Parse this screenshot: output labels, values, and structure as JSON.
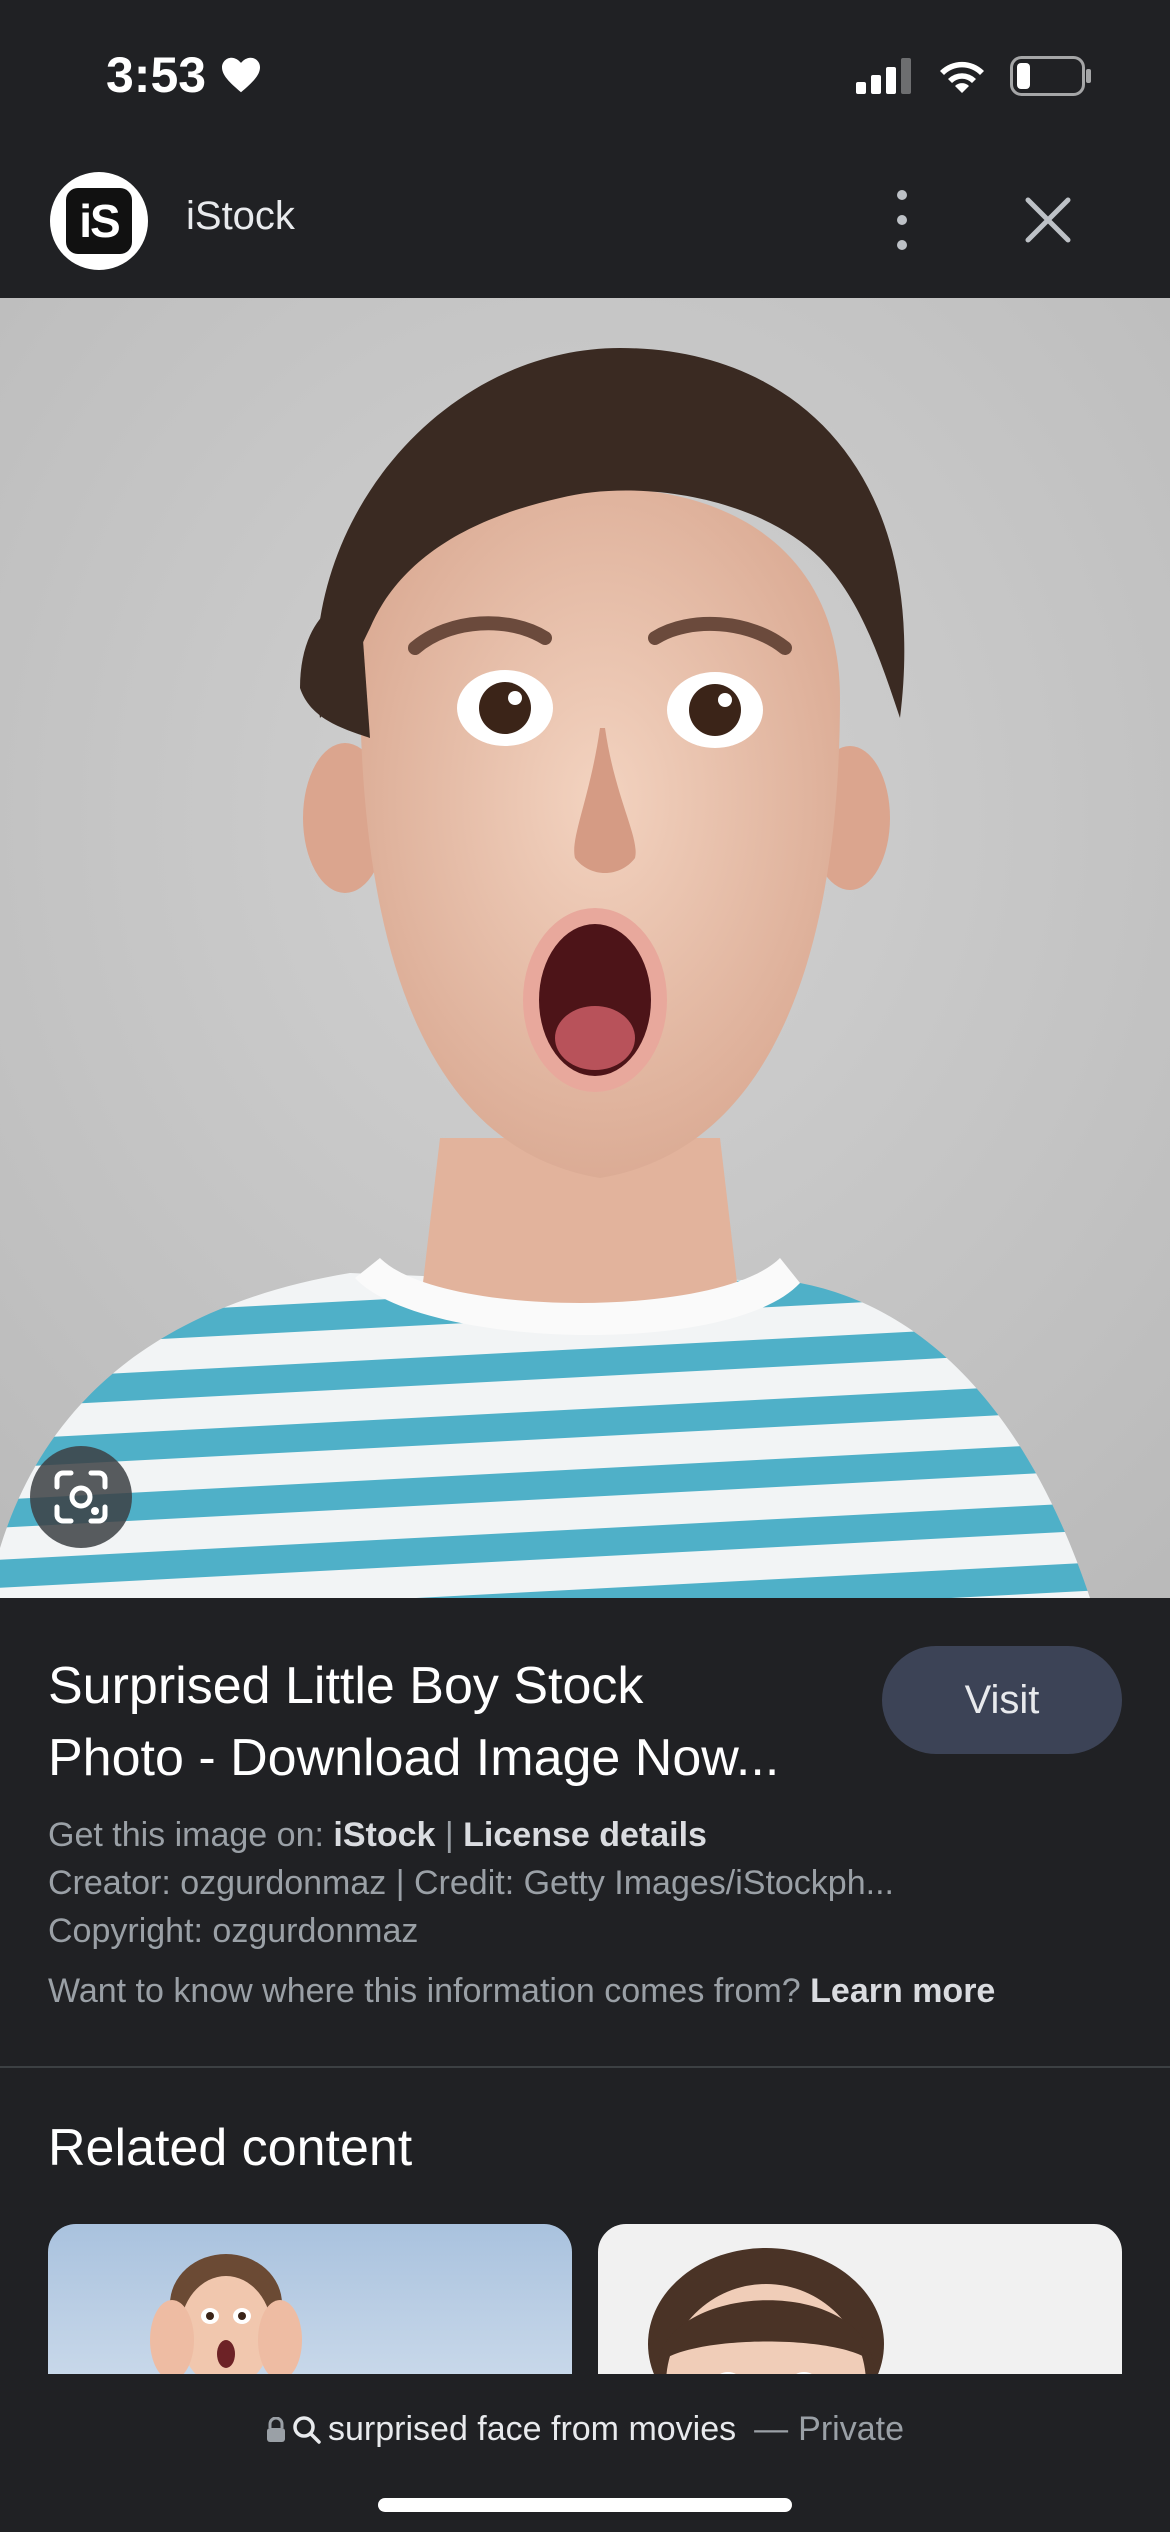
{
  "status_bar": {
    "time": "3:53",
    "icons": [
      "heart-icon",
      "signal-icon",
      "wifi-icon",
      "battery-icon"
    ]
  },
  "header": {
    "logo_text": "iS",
    "title": "iStock",
    "icons": [
      "more-vert-icon",
      "close-icon"
    ]
  },
  "image": {
    "lens_icon": "google-lens-icon"
  },
  "result": {
    "title_line1": "Surprised Little Boy Stock",
    "title_line2": "Photo - Download Image Now...",
    "visit_label": "Visit",
    "get_image_prefix": "Get this image on: ",
    "source": "iStock",
    "separator": " | ",
    "license": "License details",
    "creator": "Creator: ozgurdonmaz | Credit: Getty Images/iStockph...",
    "copyright": "Copyright: ozgurdonmaz",
    "info_question": "Want to know where this information comes from? ",
    "learn_more": "Learn more"
  },
  "related": {
    "title": "Related content"
  },
  "bottom_bar": {
    "query": "surprised face from movies",
    "dash": "—",
    "private_label": "Private",
    "icons": [
      "lock-icon",
      "search-icon"
    ]
  },
  "colors": {
    "background": "#202124",
    "visit_button": "#3c4356",
    "stripe_blue": "#4fb0c8"
  }
}
